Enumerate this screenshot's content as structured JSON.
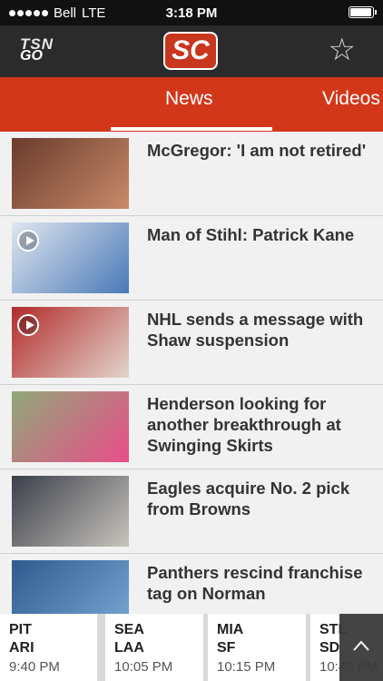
{
  "status_bar": {
    "carrier": "Bell",
    "network": "LTE",
    "time": "3:18 PM",
    "battery_level": 0.95
  },
  "header": {
    "logo_text_top": "TSN",
    "logo_text_bottom": "GO",
    "center_logo": "SC",
    "favorite_icon": "star-icon"
  },
  "tabs": [
    {
      "label": "News",
      "selected": true
    },
    {
      "label": "Videos",
      "selected": false
    }
  ],
  "news": [
    {
      "headline": "McGregor: 'I am not retired'",
      "video": false,
      "thumb_colors": [
        "#6b3b2c",
        "#c88a6a"
      ]
    },
    {
      "headline": "Man of Stihl: Patrick Kane",
      "video": true,
      "thumb_colors": [
        "#dfe6ee",
        "#4a79b8"
      ]
    },
    {
      "headline": "NHL sends a message with Shaw suspension",
      "video": true,
      "thumb_colors": [
        "#b32b2b",
        "#e2d5cc"
      ]
    },
    {
      "headline": "Henderson looking for another breakthrough at Swinging Skirts",
      "video": false,
      "thumb_colors": [
        "#8fa978",
        "#e84d8a"
      ]
    },
    {
      "headline": "Eagles acquire No. 2 pick from Browns",
      "video": false,
      "thumb_colors": [
        "#3a3f4a",
        "#c9c4bd"
      ]
    },
    {
      "headline": "Panthers rescind franchise tag on Norman",
      "video": false,
      "thumb_colors": [
        "#2e5a8e",
        "#7aa7d4"
      ]
    }
  ],
  "scores": [
    {
      "away": "PIT",
      "home": "ARI",
      "time": "9:40 PM"
    },
    {
      "away": "SEA",
      "home": "LAA",
      "time": "10:05 PM"
    },
    {
      "away": "MIA",
      "home": "SF",
      "time": "10:15 PM"
    },
    {
      "away": "STL",
      "home": "SD",
      "time": "10:40 PM"
    }
  ],
  "scroll_up_icon": "chevron-up-icon"
}
